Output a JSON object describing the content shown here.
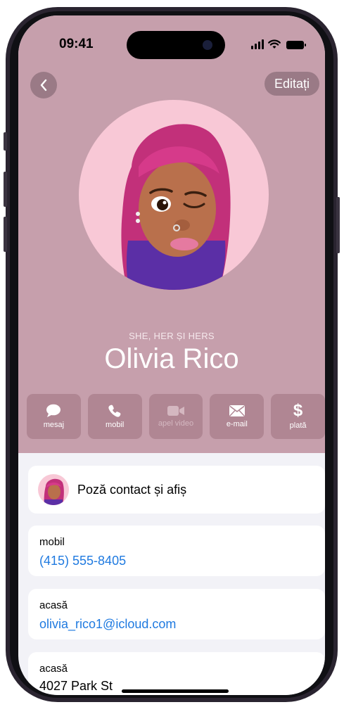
{
  "status": {
    "time": "09:41"
  },
  "nav": {
    "edit_label": "Editați"
  },
  "contact": {
    "pronouns": "SHE, HER ȘI HERS",
    "name": "Olivia Rico"
  },
  "actions": [
    {
      "label": "mesaj",
      "icon": "message-icon",
      "enabled": true
    },
    {
      "label": "mobil",
      "icon": "phone-icon",
      "enabled": true
    },
    {
      "label": "apel video",
      "icon": "video-icon",
      "enabled": false
    },
    {
      "label": "e-mail",
      "icon": "mail-icon",
      "enabled": true
    },
    {
      "label": "plată",
      "icon": "dollar-icon",
      "enabled": true
    }
  ],
  "poster_row": {
    "label": "Poză contact și afiș"
  },
  "fields": [
    {
      "label": "mobil",
      "value": "(415) 555-8405"
    },
    {
      "label": "acasă",
      "value": "olivia_rico1@icloud.com"
    },
    {
      "label": "acasă",
      "value": "4027 Park St"
    }
  ],
  "colors": {
    "header_bg": "#c69fac",
    "button_bg": "#b08693",
    "link": "#1f7ae0"
  }
}
